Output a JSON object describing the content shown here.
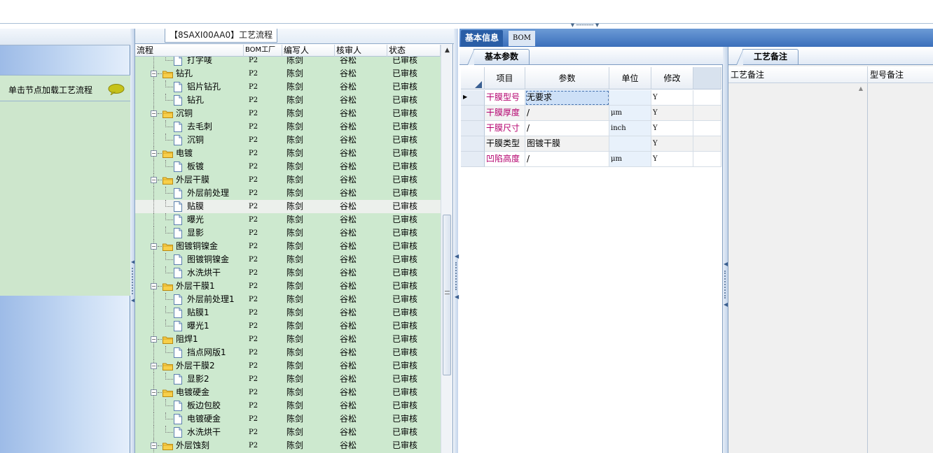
{
  "left": {
    "hint": "单击节点加载工艺流程"
  },
  "tree": {
    "title": "【8SAXI00AA0】工艺流程",
    "columns": [
      "流程",
      "BOM工厂",
      "编写人",
      "核审人",
      "状态"
    ],
    "rows": [
      {
        "level": 2,
        "label": "打字唛",
        "bom": "P2",
        "author": "陈剑",
        "reviewer": "谷松",
        "status": "已审核"
      },
      {
        "level": 1,
        "label": "钻孔",
        "bom": "P2",
        "author": "陈剑",
        "reviewer": "谷松",
        "status": "已审核"
      },
      {
        "level": 2,
        "label": "铝片钻孔",
        "bom": "P2",
        "author": "陈剑",
        "reviewer": "谷松",
        "status": "已审核"
      },
      {
        "level": 2,
        "label": "钻孔",
        "bom": "P2",
        "author": "陈剑",
        "reviewer": "谷松",
        "status": "已审核"
      },
      {
        "level": 1,
        "label": "沉铜",
        "bom": "P2",
        "author": "陈剑",
        "reviewer": "谷松",
        "status": "已审核"
      },
      {
        "level": 2,
        "label": "去毛刺",
        "bom": "P2",
        "author": "陈剑",
        "reviewer": "谷松",
        "status": "已审核"
      },
      {
        "level": 2,
        "label": "沉铜",
        "bom": "P2",
        "author": "陈剑",
        "reviewer": "谷松",
        "status": "已审核"
      },
      {
        "level": 1,
        "label": "电镀",
        "bom": "P2",
        "author": "陈剑",
        "reviewer": "谷松",
        "status": "已审核"
      },
      {
        "level": 2,
        "label": "板镀",
        "bom": "P2",
        "author": "陈剑",
        "reviewer": "谷松",
        "status": "已审核"
      },
      {
        "level": 1,
        "label": "外层干膜",
        "bom": "P2",
        "author": "陈剑",
        "reviewer": "谷松",
        "status": "已审核"
      },
      {
        "level": 2,
        "label": "外层前处理",
        "bom": "P2",
        "author": "陈剑",
        "reviewer": "谷松",
        "status": "已审核"
      },
      {
        "level": 2,
        "label": "贴膜",
        "bom": "P2",
        "author": "陈剑",
        "reviewer": "谷松",
        "status": "已审核",
        "selected": true
      },
      {
        "level": 2,
        "label": "曝光",
        "bom": "P2",
        "author": "陈剑",
        "reviewer": "谷松",
        "status": "已审核"
      },
      {
        "level": 2,
        "label": "显影",
        "bom": "P2",
        "author": "陈剑",
        "reviewer": "谷松",
        "status": "已审核"
      },
      {
        "level": 1,
        "label": "图镀铜镍金",
        "bom": "P2",
        "author": "陈剑",
        "reviewer": "谷松",
        "status": "已审核"
      },
      {
        "level": 2,
        "label": "图镀铜镍金",
        "bom": "P2",
        "author": "陈剑",
        "reviewer": "谷松",
        "status": "已审核"
      },
      {
        "level": 2,
        "label": "水洗烘干",
        "bom": "P2",
        "author": "陈剑",
        "reviewer": "谷松",
        "status": "已审核"
      },
      {
        "level": 1,
        "label": "外层干膜1",
        "bom": "P2",
        "author": "陈剑",
        "reviewer": "谷松",
        "status": "已审核"
      },
      {
        "level": 2,
        "label": "外层前处理1",
        "bom": "P2",
        "author": "陈剑",
        "reviewer": "谷松",
        "status": "已审核"
      },
      {
        "level": 2,
        "label": "贴膜1",
        "bom": "P2",
        "author": "陈剑",
        "reviewer": "谷松",
        "status": "已审核"
      },
      {
        "level": 2,
        "label": "曝光1",
        "bom": "P2",
        "author": "陈剑",
        "reviewer": "谷松",
        "status": "已审核"
      },
      {
        "level": 1,
        "label": "阻焊1",
        "bom": "P2",
        "author": "陈剑",
        "reviewer": "谷松",
        "status": "已审核"
      },
      {
        "level": 2,
        "label": "挡点网版1",
        "bom": "P2",
        "author": "陈剑",
        "reviewer": "谷松",
        "status": "已审核"
      },
      {
        "level": 1,
        "label": "外层干膜2",
        "bom": "P2",
        "author": "陈剑",
        "reviewer": "谷松",
        "status": "已审核"
      },
      {
        "level": 2,
        "label": "显影2",
        "bom": "P2",
        "author": "陈剑",
        "reviewer": "谷松",
        "status": "已审核"
      },
      {
        "level": 1,
        "label": "电镀硬金",
        "bom": "P2",
        "author": "陈剑",
        "reviewer": "谷松",
        "status": "已审核"
      },
      {
        "level": 2,
        "label": "板边包胶",
        "bom": "P2",
        "author": "陈剑",
        "reviewer": "谷松",
        "status": "已审核"
      },
      {
        "level": 2,
        "label": "电镀硬金",
        "bom": "P2",
        "author": "陈剑",
        "reviewer": "谷松",
        "status": "已审核"
      },
      {
        "level": 2,
        "label": "水洗烘干",
        "bom": "P2",
        "author": "陈剑",
        "reviewer": "谷松",
        "status": "已审核"
      },
      {
        "level": 1,
        "label": "外层蚀刻",
        "bom": "P2",
        "author": "陈剑",
        "reviewer": "谷松",
        "status": "已审核"
      }
    ]
  },
  "tabs": {
    "main": [
      "基本信息",
      "BOM"
    ],
    "basic_params": "基本参数",
    "process_notes": "工艺备注"
  },
  "params": {
    "columns": [
      "项目",
      "参数",
      "单位",
      "修改"
    ],
    "rows": [
      {
        "item": "干膜型号",
        "value": "无要求",
        "unit": "",
        "modify": "Y",
        "current": true
      },
      {
        "item": "干膜厚度",
        "value": "/",
        "unit": "μm",
        "modify": "Y"
      },
      {
        "item": "干膜尺寸",
        "value": "/",
        "unit": "inch",
        "modify": "Y"
      },
      {
        "item": "干膜类型",
        "value": "图镀干膜",
        "unit": "",
        "modify": "Y",
        "plain": true
      },
      {
        "item": "凹陷高度",
        "value": "/",
        "unit": "μm",
        "modify": "Y"
      }
    ]
  },
  "notes": {
    "columns": [
      "工艺备注",
      "型号备注"
    ]
  },
  "colors": {
    "tree_bg": "#cde9cf",
    "tab_active": "#2a5ea6",
    "item_text": "#b4006e"
  }
}
